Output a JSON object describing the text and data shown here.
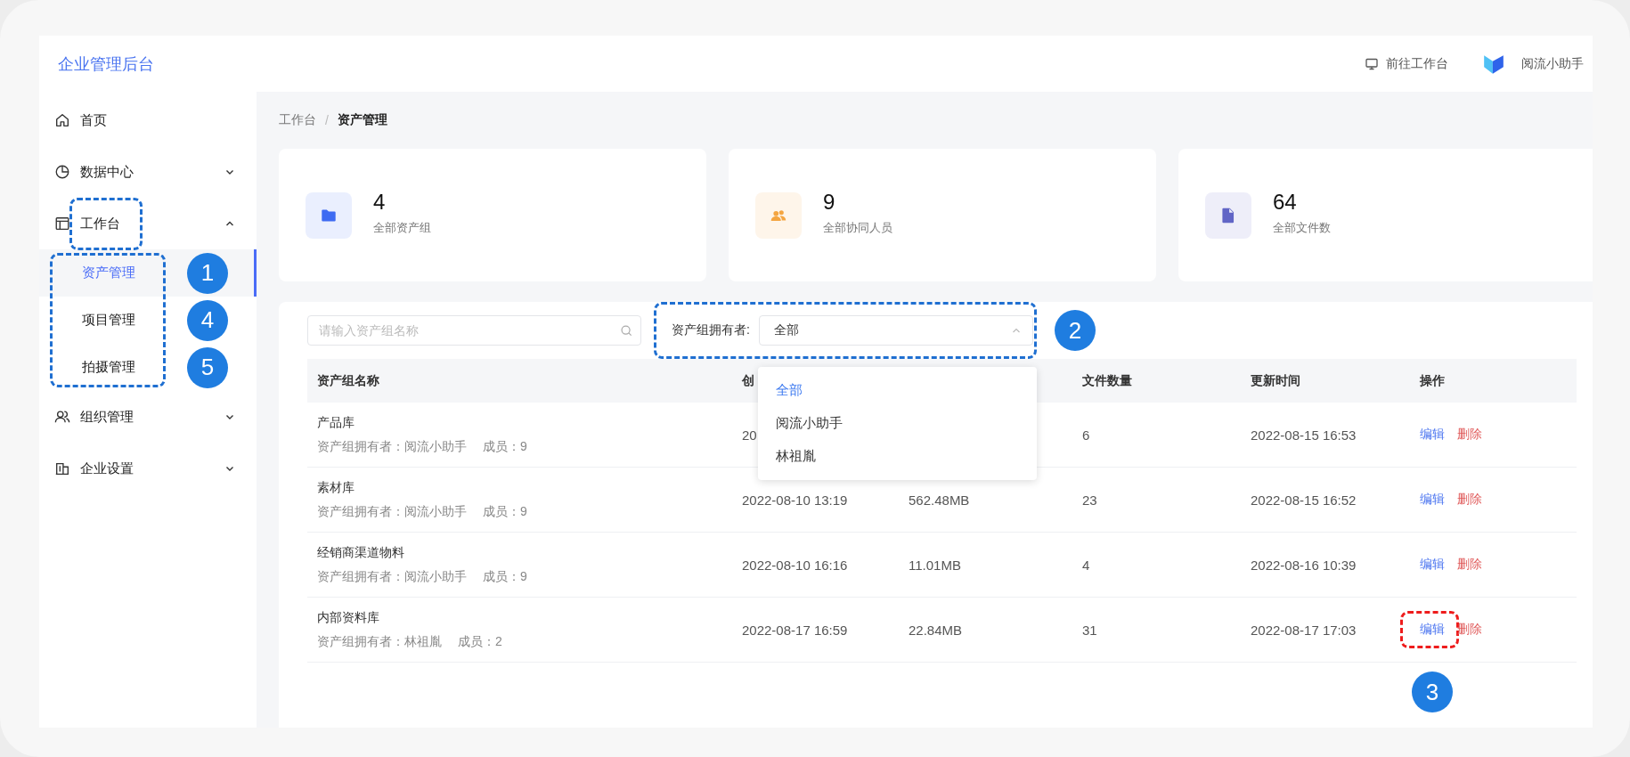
{
  "header": {
    "title": "企业管理后台",
    "links": [
      {
        "kind": "monitor",
        "label": "前往工作台"
      },
      {
        "kind": "logo",
        "label": "阅流小助手"
      }
    ]
  },
  "sidebar": {
    "items": [
      {
        "kind": "link",
        "label": "首页"
      },
      {
        "kind": "group",
        "label": "数据中心",
        "expanded": false
      },
      {
        "kind": "group",
        "label": "工作台",
        "expanded": true,
        "framed": true,
        "children_framed": true,
        "children": [
          {
            "label": "资产管理",
            "selected": true,
            "callout": "1"
          },
          {
            "label": "项目管理",
            "selected": false,
            "callout": "4"
          },
          {
            "label": "拍摄管理",
            "selected": false,
            "callout": "5"
          }
        ]
      },
      {
        "kind": "group",
        "label": "组织管理",
        "expanded": false
      },
      {
        "kind": "group",
        "label": "企业设置",
        "expanded": false
      }
    ]
  },
  "breadcrumb": {
    "items": [
      "工作台",
      "资产管理"
    ],
    "separator": "/"
  },
  "stats": [
    {
      "kind": "folder",
      "color": "#3e6bf2",
      "value": "4",
      "label": "全部资产组"
    },
    {
      "kind": "people",
      "color": "#f4a541",
      "value": "9",
      "label": "全部协同人员"
    },
    {
      "kind": "document",
      "color": "#6165c6",
      "value": "64",
      "label": "全部文件数"
    }
  ],
  "search": {
    "placeholder": "请输入资产组名称"
  },
  "filter": {
    "label": "资产组拥有者:",
    "value": "全部",
    "open": true,
    "framed": true,
    "callout": "2",
    "options": [
      {
        "label": "全部",
        "selected": true
      },
      {
        "label": "阅流小助手",
        "selected": false
      },
      {
        "label": "林祖胤",
        "selected": false
      }
    ]
  },
  "table": {
    "columns": [
      "资产组名称",
      "创",
      "文件数量",
      "更新时间",
      "操作"
    ],
    "rows": [
      {
        "name": "产品库",
        "owner": "资产组拥有者：阅流小助手",
        "members": "成员：9",
        "created": "20",
        "files": "6",
        "updated": "2022-08-15 16:53",
        "actions": [
          {
            "kind": "edit",
            "label": "编辑"
          },
          {
            "kind": "delete",
            "label": "删除"
          }
        ]
      },
      {
        "name": "素材库",
        "owner": "资产组拥有者：阅流小助手",
        "members": "成员：9",
        "created": "2022-08-10 13:19",
        "size": "562.48MB",
        "files": "23",
        "updated": "2022-08-15 16:52",
        "actions": [
          {
            "kind": "edit",
            "label": "编辑"
          },
          {
            "kind": "delete",
            "label": "删除"
          }
        ]
      },
      {
        "name": "经销商渠道物料",
        "owner": "资产组拥有者：阅流小助手",
        "members": "成员：9",
        "created": "2022-08-10 16:16",
        "size": "11.01MB",
        "files": "4",
        "updated": "2022-08-16 10:39",
        "actions": [
          {
            "kind": "edit",
            "label": "编辑"
          },
          {
            "kind": "delete",
            "label": "删除"
          }
        ]
      },
      {
        "name": "内部资料库",
        "owner": "资产组拥有者：林祖胤",
        "members": "成员：2",
        "created": "2022-08-17 16:59",
        "size": "22.84MB",
        "files": "31",
        "updated": "2022-08-17 17:03",
        "actions": [
          {
            "kind": "edit",
            "label": "编辑",
            "framed": true,
            "callout": "3"
          },
          {
            "kind": "delete",
            "label": "删除"
          }
        ]
      }
    ]
  }
}
